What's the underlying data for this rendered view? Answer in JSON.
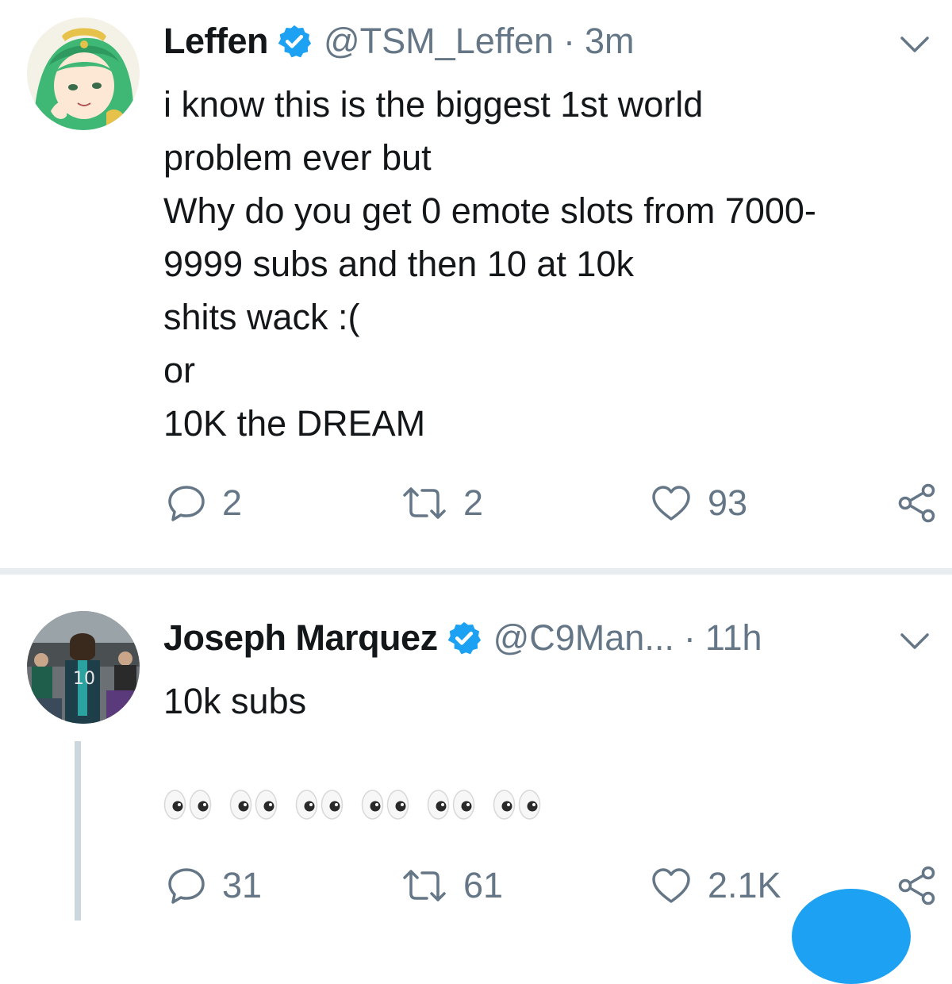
{
  "tweets": [
    {
      "name": "Leffen",
      "handle": "@TSM_Leffen",
      "separator": "·",
      "time": "3m",
      "avatar_icon": "green-haired-anime-avatar",
      "lines": [
        "i know this is the biggest 1st world",
        "problem ever but",
        "Why do you get 0 emote slots from 7000-",
        "9999 subs and then 10 at 10k",
        "shits wack :(",
        "or",
        "10K the DREAM"
      ],
      "replies": "2",
      "retweets": "2",
      "likes": "93"
    },
    {
      "name": "Joseph Marquez",
      "handle": "@C9Man...",
      "separator": "·",
      "time": "11h",
      "avatar_icon": "crowd-photo-avatar",
      "lines": [
        "10k subs"
      ],
      "emoji": [
        "eyes",
        "eyes",
        "eyes",
        "eyes",
        "eyes",
        "eyes"
      ],
      "replies": "31",
      "retweets": "61",
      "likes": "2.1K"
    }
  ],
  "colors": {
    "text": "#14171a",
    "secondary": "#657786",
    "verified": "#1da1f2",
    "divider": "#e6ecf0",
    "thread_line": "#ccd6dd",
    "fab": "#1da1f2"
  }
}
